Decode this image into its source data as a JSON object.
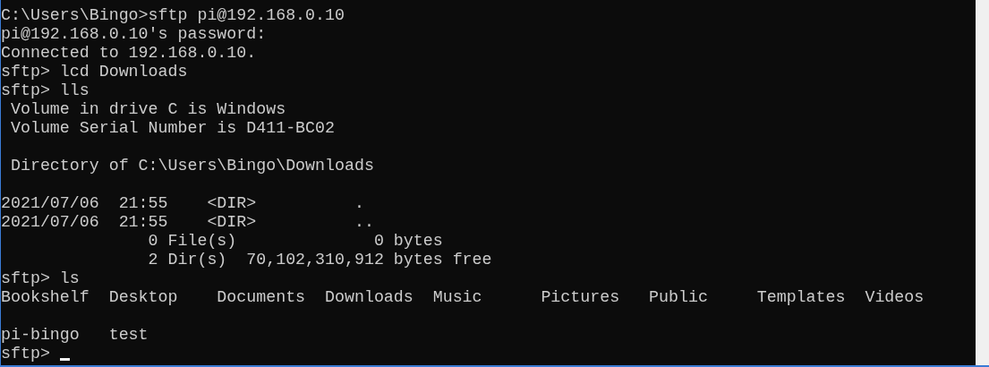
{
  "console": {
    "lines": [
      {
        "kind": "text",
        "text": "C:\\Users\\Bingo>sftp pi@192.168.0.10",
        "cursor": false
      },
      {
        "kind": "text",
        "text": "pi@192.168.0.10's password:",
        "cursor": false
      },
      {
        "kind": "text",
        "text": "Connected to 192.168.0.10.",
        "cursor": false
      },
      {
        "kind": "text",
        "text": "sftp> lcd Downloads",
        "cursor": false
      },
      {
        "kind": "text",
        "text": "sftp> lls",
        "cursor": false
      },
      {
        "kind": "text",
        "text": " Volume in drive C is Windows",
        "cursor": false
      },
      {
        "kind": "text",
        "text": " Volume Serial Number is D411-BC02",
        "cursor": false
      },
      {
        "kind": "blank"
      },
      {
        "kind": "text",
        "text": " Directory of C:\\Users\\Bingo\\Downloads",
        "cursor": false
      },
      {
        "kind": "blank"
      },
      {
        "kind": "text",
        "text": "2021/07/06  21:55    <DIR>          .",
        "cursor": false
      },
      {
        "kind": "text",
        "text": "2021/07/06  21:55    <DIR>          ..",
        "cursor": false
      },
      {
        "kind": "text",
        "text": "               0 File(s)              0 bytes",
        "cursor": false
      },
      {
        "kind": "text",
        "text": "               2 Dir(s)  70,102,310,912 bytes free",
        "cursor": false
      },
      {
        "kind": "text",
        "text": "sftp> ls",
        "cursor": false
      },
      {
        "kind": "text",
        "text": "Bookshelf  Desktop    Documents  Downloads  Music      Pictures   Public     Templates  Videos",
        "cursor": false
      },
      {
        "kind": "blank"
      },
      {
        "kind": "text",
        "text": "pi-bingo   test",
        "cursor": false
      },
      {
        "kind": "text",
        "text": "sftp> ",
        "cursor": true
      }
    ]
  }
}
